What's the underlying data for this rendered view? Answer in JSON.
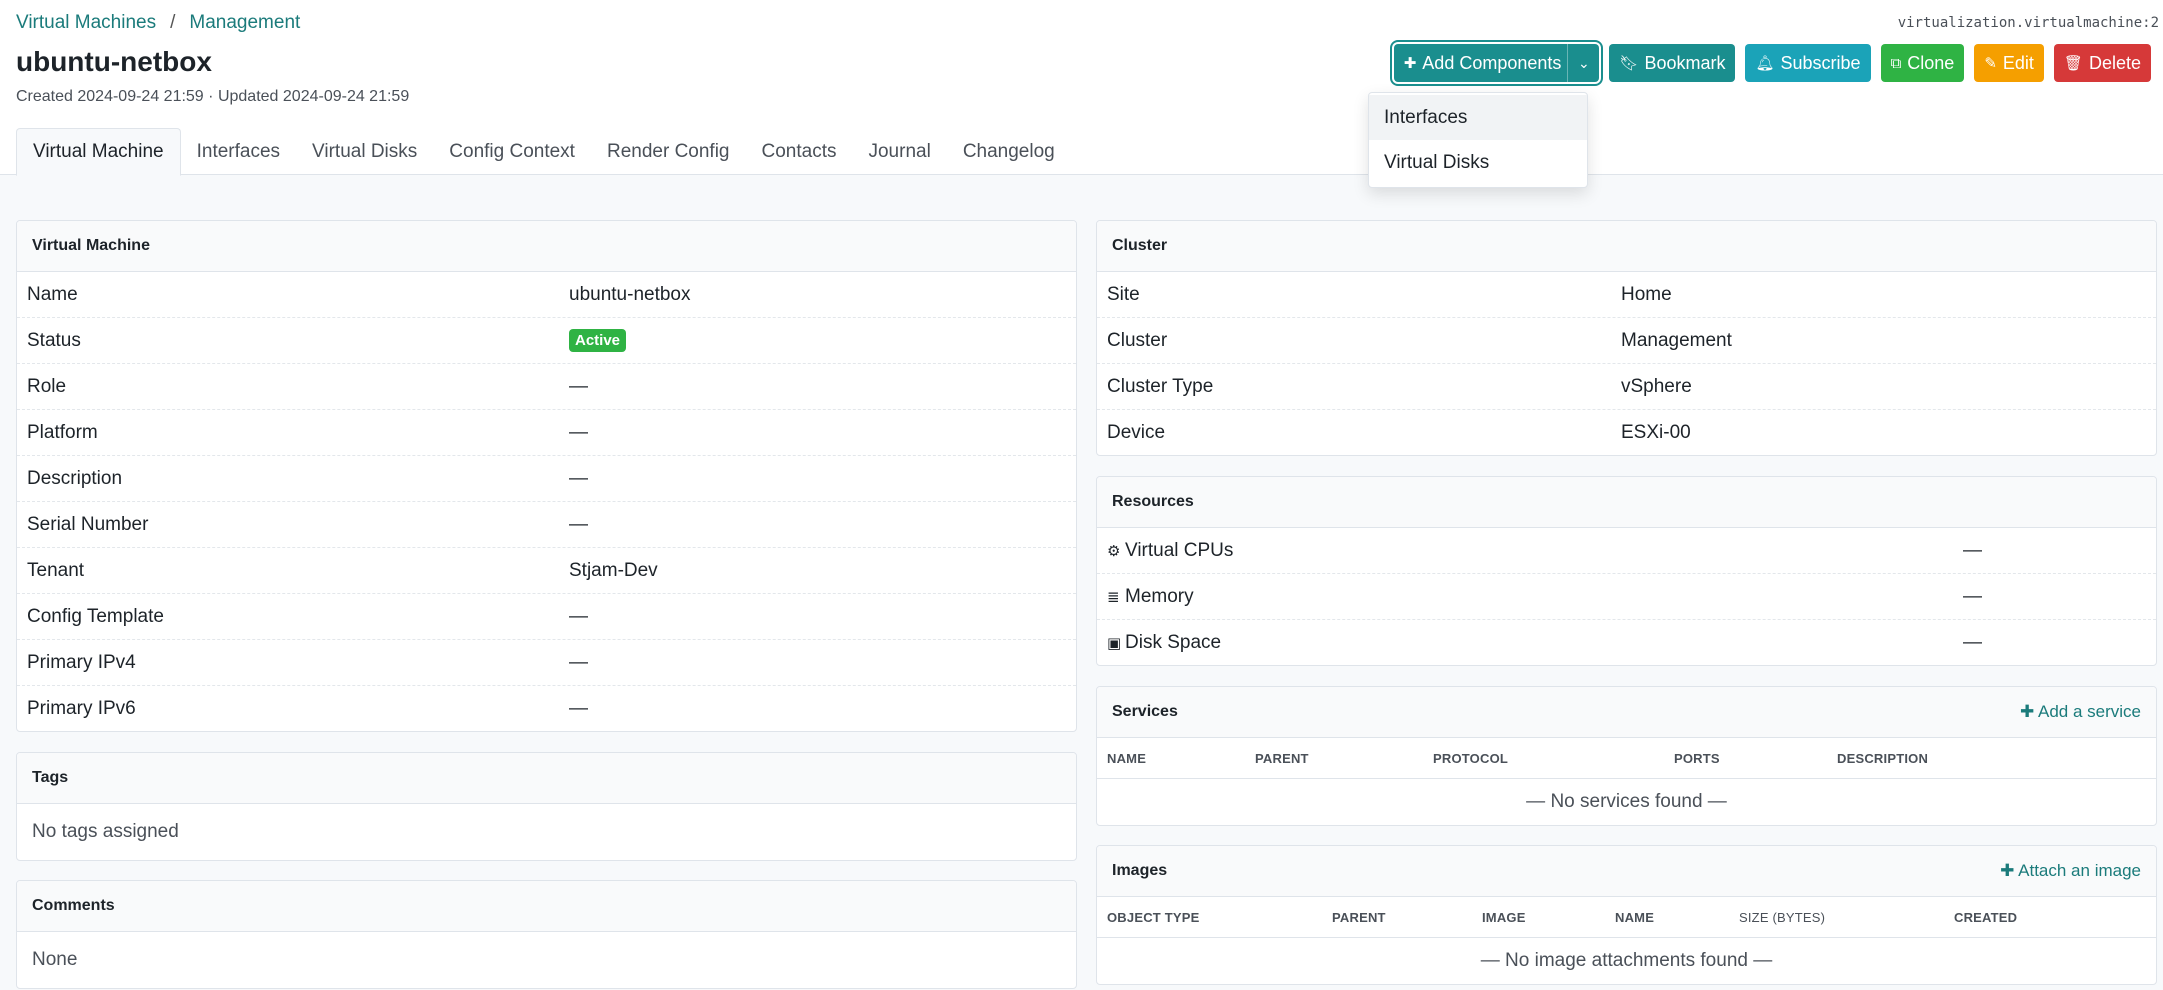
{
  "breadcrumb": {
    "items": [
      "Virtual Machines",
      "Management"
    ],
    "separator": "/"
  },
  "page_title": "ubuntu-netbox",
  "meta": {
    "created_label": "Created",
    "created": "2024-09-24 21:59",
    "separator": "·",
    "updated_label": "Updated",
    "updated": "2024-09-24 21:59"
  },
  "object_type": "virtualization.virtualmachine:2",
  "actions": {
    "add_components": "Add Components",
    "bookmark": "Bookmark",
    "subscribe": "Subscribe",
    "clone": "Clone",
    "edit": "Edit",
    "delete": "Delete"
  },
  "dropdown": {
    "items": [
      "Interfaces",
      "Virtual Disks"
    ]
  },
  "tabs": [
    "Virtual Machine",
    "Interfaces",
    "Virtual Disks",
    "Config Context",
    "Render Config",
    "Contacts",
    "Journal",
    "Changelog"
  ],
  "vm_card": {
    "title": "Virtual Machine",
    "rows": [
      {
        "key": "Name",
        "value": "ubuntu-netbox"
      },
      {
        "key": "Status",
        "value": "Active"
      },
      {
        "key": "Role",
        "value": "—"
      },
      {
        "key": "Platform",
        "value": "—"
      },
      {
        "key": "Description",
        "value": "—"
      },
      {
        "key": "Serial Number",
        "value": "—"
      },
      {
        "key": "Tenant",
        "value": "Stjam-Dev"
      },
      {
        "key": "Config Template",
        "value": "—"
      },
      {
        "key": "Primary IPv4",
        "value": "—"
      },
      {
        "key": "Primary IPv6",
        "value": "—"
      }
    ]
  },
  "tags_card": {
    "title": "Tags",
    "text": "No tags assigned"
  },
  "comments_card": {
    "title": "Comments",
    "text": "None"
  },
  "cluster_card": {
    "title": "Cluster",
    "rows": [
      {
        "key": "Site",
        "value": "Home"
      },
      {
        "key": "Cluster",
        "value": "Management"
      },
      {
        "key": "Cluster Type",
        "value": "vSphere"
      },
      {
        "key": "Device",
        "value": "ESXi-00"
      }
    ]
  },
  "resources_card": {
    "title": "Resources",
    "rows": [
      {
        "key": "Virtual CPUs",
        "value": "—",
        "icon": "cpu-icon"
      },
      {
        "key": "Memory",
        "value": "—",
        "icon": "memory-icon"
      },
      {
        "key": "Disk Space",
        "value": "—",
        "icon": "disk-icon"
      }
    ]
  },
  "services_card": {
    "title": "Services",
    "link": "Add a service",
    "columns": [
      "Name",
      "Parent",
      "Protocol",
      "Ports",
      "Description"
    ],
    "empty": "— No services found —"
  },
  "images_card": {
    "title": "Images",
    "link": "Attach an image",
    "columns": [
      "Object Type",
      "Parent",
      "Image",
      "Name",
      "Size (Bytes)",
      "Created"
    ],
    "empty": "— No image attachments found —"
  },
  "colors": {
    "accent": "#1a8e8e",
    "cyan": "#1ba3b8",
    "green": "#2fb344",
    "orange": "#f59f00",
    "red": "#d63939",
    "link": "#1b7b7b"
  }
}
